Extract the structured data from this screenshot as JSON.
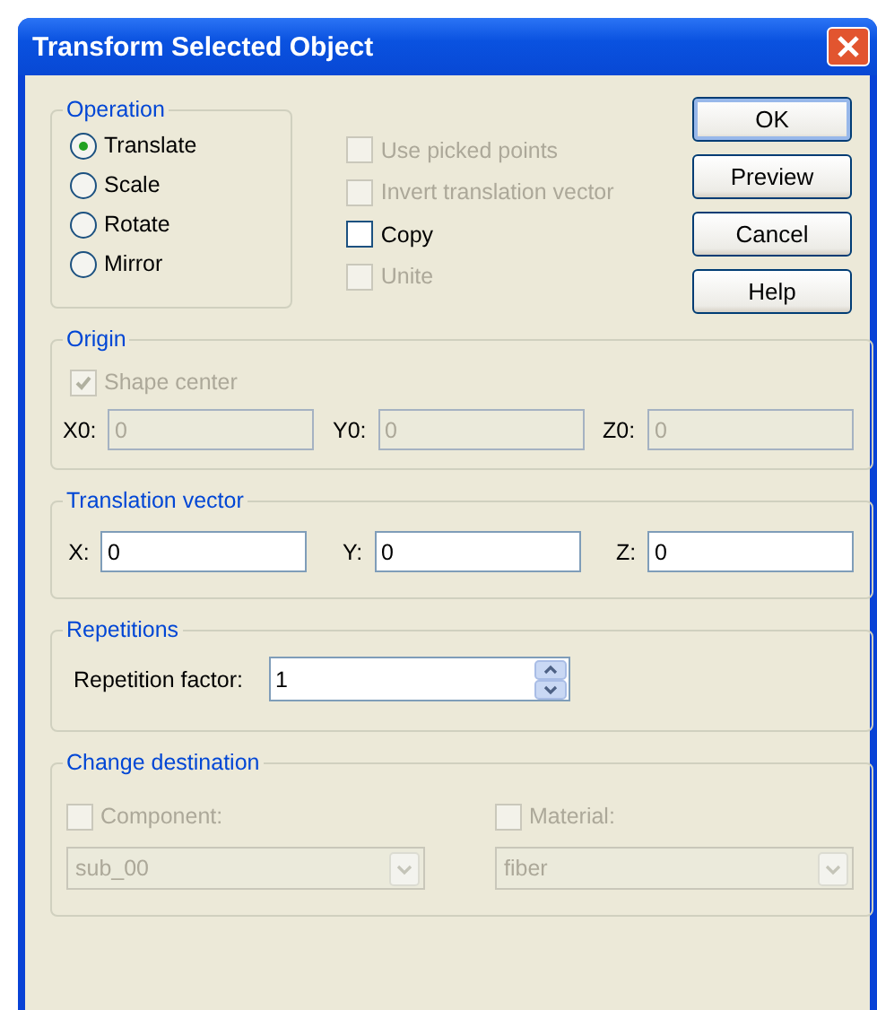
{
  "window": {
    "title": "Transform Selected Object"
  },
  "operation": {
    "title": "Operation",
    "options": [
      {
        "label": "Translate",
        "selected": true
      },
      {
        "label": "Scale",
        "selected": false
      },
      {
        "label": "Rotate",
        "selected": false
      },
      {
        "label": "Mirror",
        "selected": false
      }
    ]
  },
  "options": [
    {
      "label": "Use picked points",
      "checked": false,
      "disabled": true
    },
    {
      "label": "Invert translation vector",
      "checked": false,
      "disabled": true
    },
    {
      "label": "Copy",
      "checked": false,
      "disabled": false
    },
    {
      "label": "Unite",
      "checked": false,
      "disabled": true
    }
  ],
  "buttons": [
    {
      "label": "OK",
      "default": true
    },
    {
      "label": "Preview",
      "default": false
    },
    {
      "label": "Cancel",
      "default": false
    },
    {
      "label": "Help",
      "default": false
    }
  ],
  "origin": {
    "title": "Origin",
    "shape_center": {
      "label": "Shape center",
      "checked": true,
      "disabled": true
    },
    "fields": [
      {
        "label": "X0:",
        "value": "0",
        "disabled": true
      },
      {
        "label": "Y0:",
        "value": "0",
        "disabled": true
      },
      {
        "label": "Z0:",
        "value": "0",
        "disabled": true
      }
    ]
  },
  "translation_vector": {
    "title": "Translation vector",
    "fields": [
      {
        "label": "X:",
        "value": "0",
        "disabled": false
      },
      {
        "label": "Y:",
        "value": "0",
        "disabled": false
      },
      {
        "label": "Z:",
        "value": "0",
        "disabled": false
      }
    ]
  },
  "repetitions": {
    "title": "Repetitions",
    "label": "Repetition factor:",
    "value": "1"
  },
  "change_destination": {
    "title": "Change destination",
    "items": [
      {
        "label": "Component:",
        "checked": false,
        "disabled": true,
        "value": "sub_00"
      },
      {
        "label": "Material:",
        "checked": false,
        "disabled": true,
        "value": "fiber"
      }
    ]
  }
}
